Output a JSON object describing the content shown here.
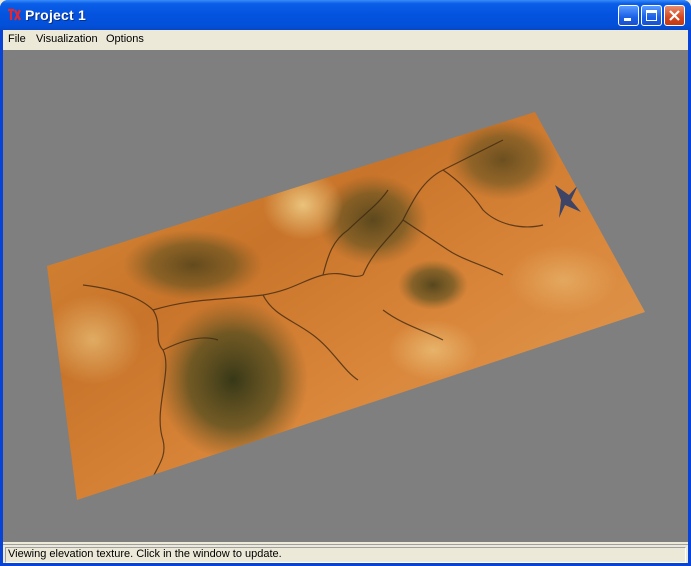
{
  "window": {
    "title": "Project 1"
  },
  "menu": {
    "items": [
      "File",
      "Visualization",
      "Options"
    ]
  },
  "status": {
    "text": "Viewing elevation texture. Click in the window to update."
  },
  "colors": {
    "viewport_bg": "#7F7F7F",
    "terrain_base": "#D9862F",
    "terrain_dark": "#3E3A1A",
    "titlebar": "#0453DE"
  },
  "icons": {
    "app": "app-logo-icon",
    "minimize": "minimize-icon",
    "maximize": "maximize-icon",
    "close": "close-icon"
  }
}
